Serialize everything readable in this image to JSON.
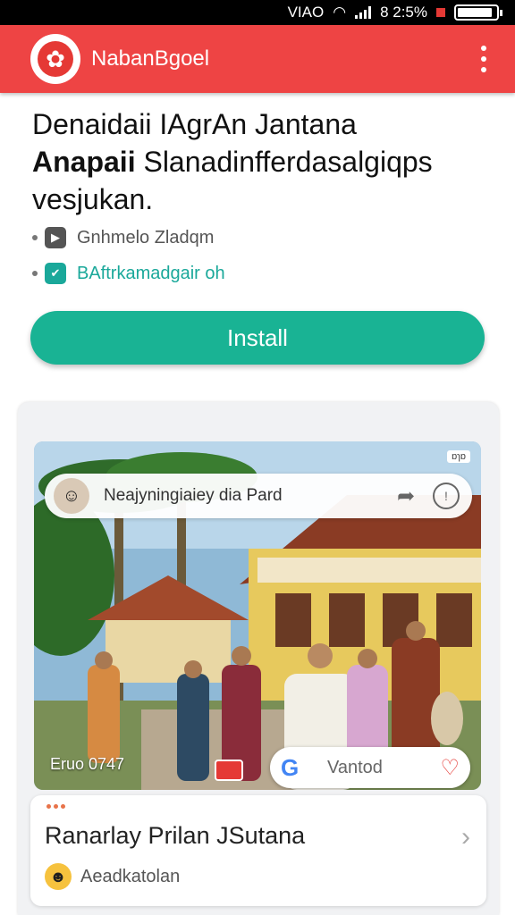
{
  "status_bar": {
    "carrier": "VIAO",
    "time": "8 2:5%"
  },
  "app_bar": {
    "title": "NabanBgoel"
  },
  "headline": {
    "line1": "Denaidaii IAgrAn Jantana",
    "bold_word": "Anapaii",
    "rest": "Slanadinfferdasalgiqps vesjukan."
  },
  "bullets": [
    {
      "icon": "app-icon",
      "text": "Gnhmelo Zladqm"
    },
    {
      "icon": "message-icon",
      "text": "BAftrkamadgair oh"
    }
  ],
  "install_label": "Install",
  "ad": {
    "badge": "ɒɿɒ",
    "search_text": "Neajyningiaiey dia Pard",
    "counter": "Eruo 0747",
    "g_pill_text": "Vantod"
  },
  "item_card": {
    "title": "Ranarlay Prilan JSutana",
    "subtitle": "Aeadkatolan"
  },
  "colors": {
    "brand": "#ee4444",
    "accent": "#19b394"
  }
}
